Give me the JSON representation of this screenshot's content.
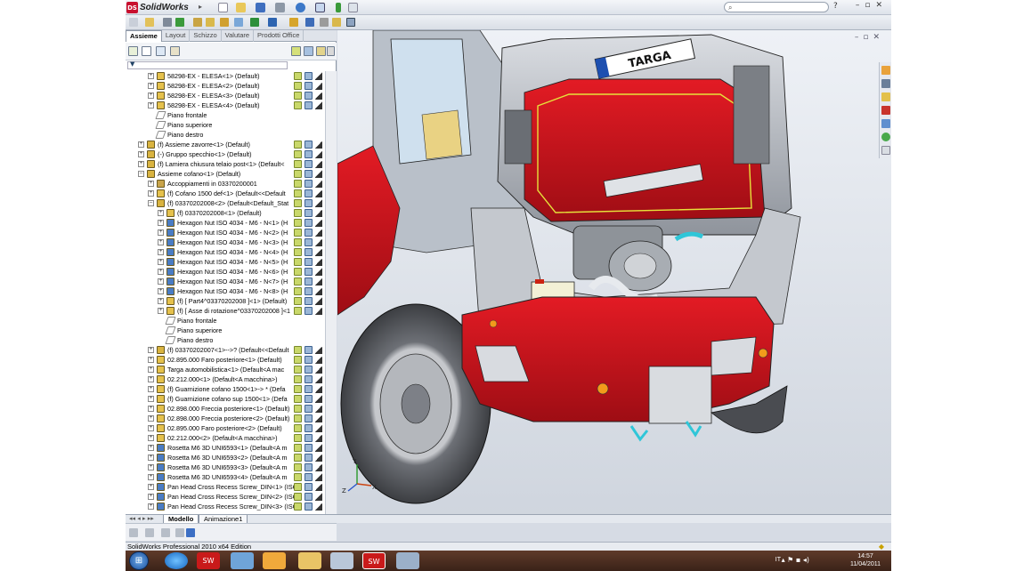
{
  "app": {
    "name": "SolidWorks",
    "search_icon": "search-icon",
    "help": "?"
  },
  "tabs": [
    "Assieme",
    "Layout",
    "Schizzo",
    "Valutare",
    "Prodotti Office"
  ],
  "tree": [
    {
      "lvl": 1,
      "exp": "+",
      "icon": "part",
      "text": "58298-EX - ELESA<1> (Default)"
    },
    {
      "lvl": 1,
      "exp": "+",
      "icon": "part",
      "text": "58298-EX - ELESA<2> (Default)"
    },
    {
      "lvl": 1,
      "exp": "+",
      "icon": "part",
      "text": "58298-EX - ELESA<3> (Default)"
    },
    {
      "lvl": 1,
      "exp": "+",
      "icon": "part",
      "text": "58298-EX - ELESA<4> (Default)"
    },
    {
      "lvl": 1,
      "exp": "",
      "icon": "plane",
      "text": "Piano frontale"
    },
    {
      "lvl": 1,
      "exp": "",
      "icon": "plane",
      "text": "Piano superiore"
    },
    {
      "lvl": 1,
      "exp": "",
      "icon": "plane",
      "text": "Piano destro"
    },
    {
      "lvl": 0,
      "exp": "+",
      "icon": "asm",
      "text": "(f) Assieme zavorre<1> (Default)"
    },
    {
      "lvl": 0,
      "exp": "+",
      "icon": "asm",
      "text": "(-) Gruppo specchio<1> (Default)"
    },
    {
      "lvl": 0,
      "exp": "+",
      "icon": "asm",
      "text": "(f) Lamiera chiusura telaio post<1> (Default<"
    },
    {
      "lvl": 0,
      "exp": "-",
      "icon": "asm",
      "text": "Assieme cofano<1> (Default)"
    },
    {
      "lvl": 1,
      "exp": "+",
      "icon": "mate",
      "text": "Accoppiamenti in 03370200001"
    },
    {
      "lvl": 1,
      "exp": "+",
      "icon": "part",
      "text": "(f) Cofano 1500 def<1> (Default<<Default"
    },
    {
      "lvl": 1,
      "exp": "-",
      "icon": "asm",
      "text": "(f) 03370202008<2> (Default<Default_Stat"
    },
    {
      "lvl": 2,
      "exp": "+",
      "icon": "part",
      "text": "(f) 03370202008<1> (Default)"
    },
    {
      "lvl": 2,
      "exp": "+",
      "icon": "nut",
      "text": "Hexagon Nut ISO 4034 - M6 - N<1> (H"
    },
    {
      "lvl": 2,
      "exp": "+",
      "icon": "nut",
      "text": "Hexagon Nut ISO 4034 - M6 - N<2> (H"
    },
    {
      "lvl": 2,
      "exp": "+",
      "icon": "nut",
      "text": "Hexagon Nut ISO 4034 - M6 - N<3> (H"
    },
    {
      "lvl": 2,
      "exp": "+",
      "icon": "nut",
      "text": "Hexagon Nut ISO 4034 - M6 - N<4> (H"
    },
    {
      "lvl": 2,
      "exp": "+",
      "icon": "nut",
      "text": "Hexagon Nut ISO 4034 - M6 - N<5> (H"
    },
    {
      "lvl": 2,
      "exp": "+",
      "icon": "nut",
      "text": "Hexagon Nut ISO 4034 - M6 - N<6> (H"
    },
    {
      "lvl": 2,
      "exp": "+",
      "icon": "nut",
      "text": "Hexagon Nut ISO 4034 - M6 - N<7> (H"
    },
    {
      "lvl": 2,
      "exp": "+",
      "icon": "nut",
      "text": "Hexagon Nut ISO 4034 - M6 - N<8> (H"
    },
    {
      "lvl": 2,
      "exp": "+",
      "icon": "part",
      "text": "(f) [ Part4^03370202008 ]<1> (Default)"
    },
    {
      "lvl": 2,
      "exp": "+",
      "icon": "part",
      "text": "(f) [ Asse di rotazione^03370202008 ]<1"
    },
    {
      "lvl": 2,
      "exp": "",
      "icon": "plane",
      "text": "Piano frontale"
    },
    {
      "lvl": 2,
      "exp": "",
      "icon": "plane",
      "text": "Piano superiore"
    },
    {
      "lvl": 2,
      "exp": "",
      "icon": "plane",
      "text": "Piano destro"
    },
    {
      "lvl": 1,
      "exp": "+",
      "icon": "asm",
      "text": "(f) 03370202007<1>-->? (Default<<Default"
    },
    {
      "lvl": 1,
      "exp": "+",
      "icon": "part",
      "text": "02.895.000 Faro posteriore<1> (Default)"
    },
    {
      "lvl": 1,
      "exp": "+",
      "icon": "part",
      "text": "Targa automobilistica<1> (Default<A mac"
    },
    {
      "lvl": 1,
      "exp": "+",
      "icon": "part",
      "text": "02.212.000<1> (Default<A macchina>)"
    },
    {
      "lvl": 1,
      "exp": "+",
      "icon": "part",
      "text": "(f) Guarnizione cofano 1500<1>-> * (Defa"
    },
    {
      "lvl": 1,
      "exp": "+",
      "icon": "part",
      "text": "(f) Guarnizione cofano sup 1500<1> (Defa"
    },
    {
      "lvl": 1,
      "exp": "+",
      "icon": "part",
      "text": "02.898.000 Freccia posteriore<1> (Default)"
    },
    {
      "lvl": 1,
      "exp": "+",
      "icon": "part",
      "text": "02.898.000 Freccia posteriore<2> (Default)"
    },
    {
      "lvl": 1,
      "exp": "+",
      "icon": "part",
      "text": "02.895.000 Faro posteriore<2> (Default)"
    },
    {
      "lvl": 1,
      "exp": "+",
      "icon": "part",
      "text": "02.212.000<2> (Default<A macchina>)"
    },
    {
      "lvl": 1,
      "exp": "+",
      "icon": "nut",
      "text": "Rosetta M6 3D UNI6593<1> (Default<A m"
    },
    {
      "lvl": 1,
      "exp": "+",
      "icon": "nut",
      "text": "Rosetta M6 3D UNI6593<2> (Default<A m"
    },
    {
      "lvl": 1,
      "exp": "+",
      "icon": "nut",
      "text": "Rosetta M6 3D UNI6593<3> (Default<A m"
    },
    {
      "lvl": 1,
      "exp": "+",
      "icon": "nut",
      "text": "Rosetta M6 3D UNI6593<4> (Default<A m"
    },
    {
      "lvl": 1,
      "exp": "+",
      "icon": "nut",
      "text": "Pan Head Cross Recess Screw_DIN<1> (ISC"
    },
    {
      "lvl": 1,
      "exp": "+",
      "icon": "nut",
      "text": "Pan Head Cross Recess Screw_DIN<2> (ISC"
    },
    {
      "lvl": 1,
      "exp": "+",
      "icon": "nut",
      "text": "Pan Head Cross Recess Screw_DIN<3> (ISC"
    }
  ],
  "viewport": {
    "plate_text": "TARGA",
    "triad": {
      "x": "X",
      "y": "Y",
      "z": "Z"
    }
  },
  "bottom_tabs": [
    "Modello",
    "Animazione1"
  ],
  "status": {
    "text": "SolidWorks Professional 2010 x64 Edition"
  },
  "taskbar": {
    "lang": "IT",
    "time": "14:57",
    "date": "11/04/2011"
  },
  "colors": {
    "body_red": "#c8101a",
    "panel_bg": "#ffffff"
  }
}
